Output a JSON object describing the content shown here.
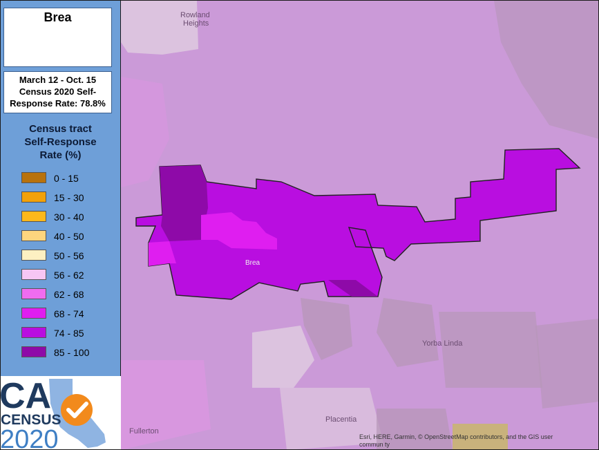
{
  "sidebar": {
    "city": "Brea",
    "rate_lines": [
      "March 12 - Oct. 15",
      "Census 2020 Self-",
      "Response Rate: 78.8%"
    ],
    "legend_title_lines": [
      "Census tract",
      "Self-Response",
      "Rate (%)"
    ],
    "legend": [
      {
        "label": "0 - 15",
        "color": "#b8720d"
      },
      {
        "label": "15 - 30",
        "color": "#f2a10a"
      },
      {
        "label": "30 - 40",
        "color": "#fdb81b"
      },
      {
        "label": "40 - 50",
        "color": "#fdd57e"
      },
      {
        "label": "50 - 56",
        "color": "#fdf0c2"
      },
      {
        "label": "56 - 62",
        "color": "#f6c6f4"
      },
      {
        "label": "62 - 68",
        "color": "#f06cf0"
      },
      {
        "label": "68 - 74",
        "color": "#df1ef0"
      },
      {
        "label": "74 - 85",
        "color": "#b90ee0"
      },
      {
        "label": "85 - 100",
        "color": "#8e0aa8"
      }
    ]
  },
  "logo": {
    "line1": "CA",
    "line2": "CENSUS",
    "line3": "2020"
  },
  "map": {
    "labels": {
      "rowland": "Rowland Heights",
      "rowland_line1": "Rowland",
      "rowland_line2": "Heights",
      "brea": "Brea",
      "yorba_linda": "Yorba Linda",
      "placentia": "Placentia",
      "fullerton": "Fullerton"
    },
    "attribution_line1": "Esri, HERE, Garmin, © OpenStreetMap contributors, and the GIS user",
    "attribution_line2": "commun ty",
    "colors": {
      "background": "#cb9ad8",
      "light_tract": "#dcc3df",
      "gray_tract": "#b596b7",
      "pink_tract": "#dd96e2",
      "tan_tract": "#c9b27c"
    }
  }
}
